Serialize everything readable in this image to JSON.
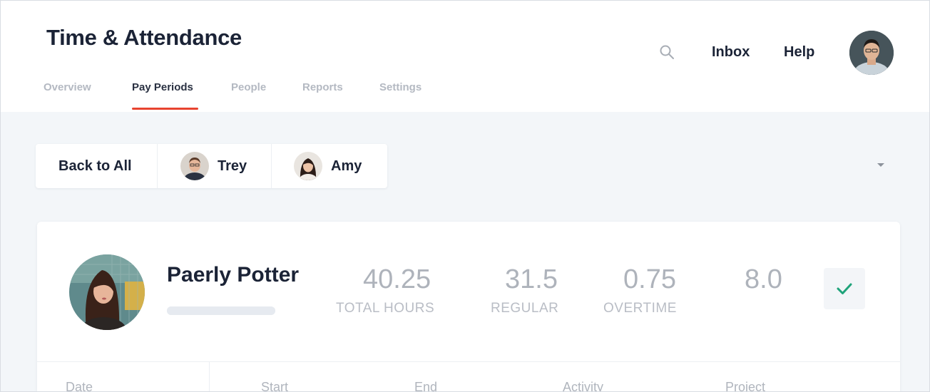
{
  "app": {
    "title": "Time & Attendance"
  },
  "nav": {
    "tabs": [
      {
        "label": "Overview"
      },
      {
        "label": "Pay Periods"
      },
      {
        "label": "People"
      },
      {
        "label": "Reports"
      },
      {
        "label": "Settings"
      }
    ],
    "active_tab": "Pay Periods"
  },
  "header_links": {
    "inbox": "Inbox",
    "help": "Help"
  },
  "switcher": {
    "back_label": "Back to All",
    "people": [
      {
        "name": "Trey"
      },
      {
        "name": "Amy"
      }
    ]
  },
  "person": {
    "name": "Paerly Potter",
    "stats": [
      {
        "value": "40.25",
        "label": "TOTAL HOURS"
      },
      {
        "value": "31.5",
        "label": "REGULAR"
      },
      {
        "value": "0.75",
        "label": "OVERTIME"
      },
      {
        "value": "8.0",
        "label": ""
      }
    ]
  },
  "table": {
    "columns": [
      "Date",
      "Start",
      "End",
      "Activity",
      "Project"
    ]
  },
  "colors": {
    "accent": "#e8432f",
    "approve": "#1fa37a",
    "title": "#1b2336"
  }
}
